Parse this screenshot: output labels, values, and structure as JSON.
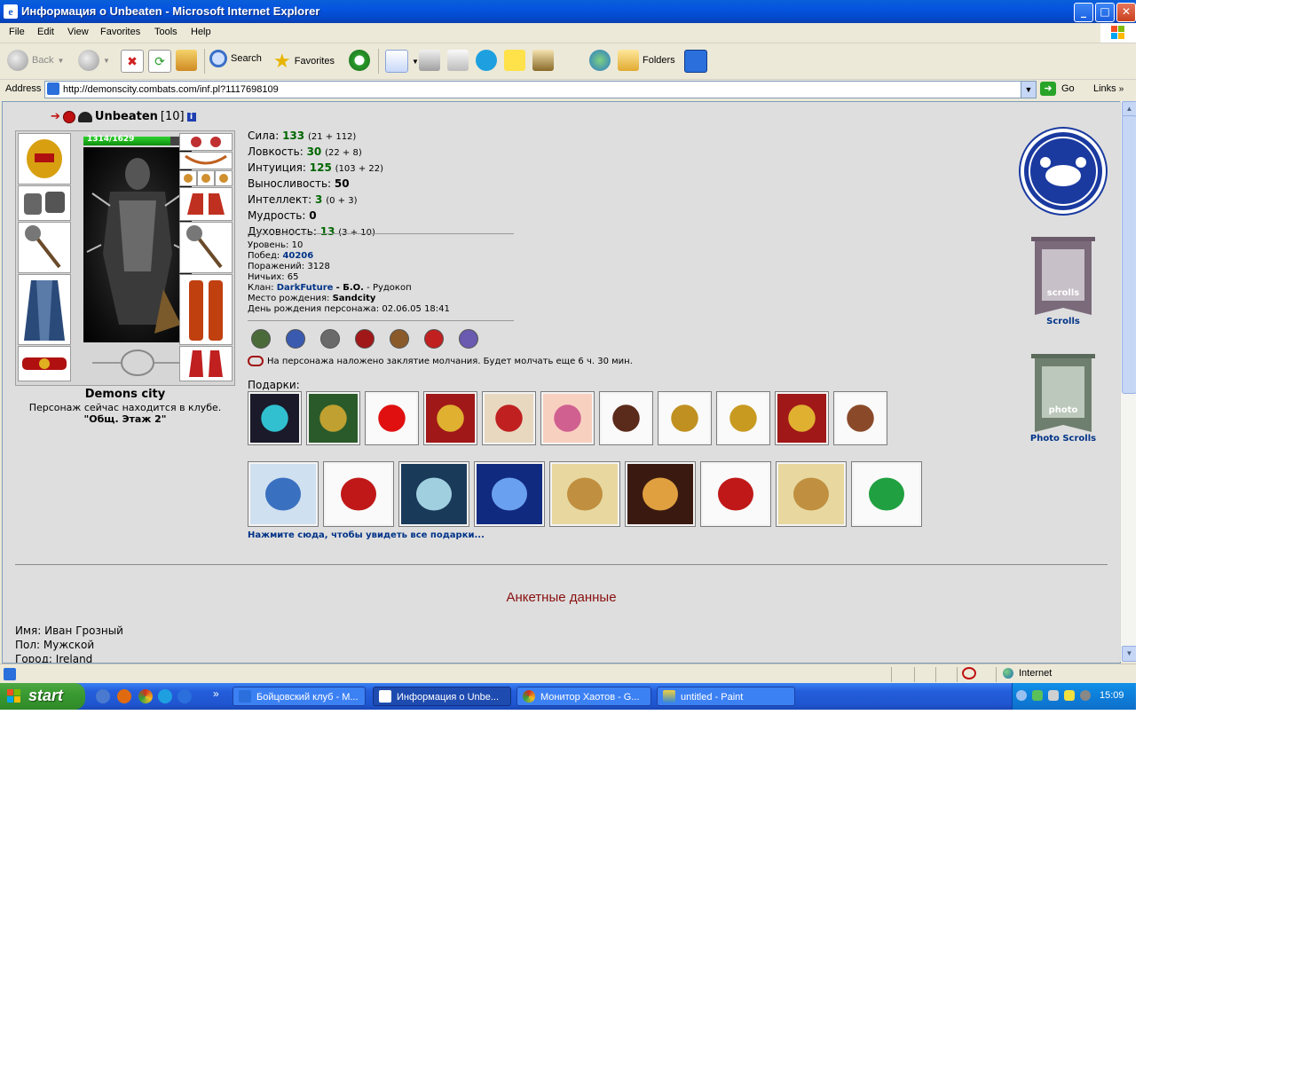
{
  "window": {
    "title": "Информация о Unbeaten - Microsoft Internet Explorer",
    "controls": {
      "minimize": "_",
      "maximize": "□",
      "close": "✕"
    }
  },
  "menu": [
    "File",
    "Edit",
    "View",
    "Favorites",
    "Tools",
    "Help"
  ],
  "toolbar": {
    "back": "Back",
    "search": "Search",
    "favorites": "Favorites",
    "folders": "Folders"
  },
  "address": {
    "label": "Address",
    "url": "http://demonscity.combats.com/inf.pl?1117698109",
    "go": "Go",
    "links": "Links"
  },
  "character": {
    "name": "Unbeaten",
    "level": "[10]",
    "hp": "1314/1629",
    "hp_fraction": 0.807,
    "city": "Demons city",
    "location_line": "Персонаж сейчас находится в клубе.",
    "room": "\"Общ. Этаж 2\""
  },
  "stats": [
    {
      "label": "Сила:",
      "value": "133",
      "base": "(21 + 112)",
      "color": "green"
    },
    {
      "label": "Ловкость:",
      "value": "30",
      "base": "(22 + 8)",
      "color": "green"
    },
    {
      "label": "Интуиция:",
      "value": "125",
      "base": "(103 + 22)",
      "color": "green"
    },
    {
      "label": "Выносливость:",
      "value": "50",
      "base": "",
      "color": "black"
    },
    {
      "label": "Интеллект:",
      "value": "3",
      "base": "(0 + 3)",
      "color": "green"
    },
    {
      "label": "Мудрость:",
      "value": "0",
      "base": "",
      "color": "black"
    },
    {
      "label": "Духовность:",
      "value": "13",
      "base": "(3 + 10)",
      "color": "green"
    }
  ],
  "info": {
    "level": "Уровень: 10",
    "wins_label": "Побед:",
    "wins": "40206",
    "losses": "Поражений: 3128",
    "draws": "Ничьих: 65",
    "clan_label": "Клан:",
    "clan": "DarkFuture",
    "clan_rank": "- Б.О.",
    "clan_role": "- Рудокоп",
    "birthplace_label": "Место рождения:",
    "birthplace": "Sandcity",
    "birthday": "День рождения персонажа: 02.06.05 18:41"
  },
  "silence": "На персонажа наложено заклятие молчания. Будет молчать еще 6 ч. 30 мин.",
  "gifts_label": "Подарки:",
  "gifts_more": "Нажмите сюда, чтобы увидеть все подарки...",
  "gifts_row1": [
    "dark-book-icon",
    "green-book-icon",
    "clown-nose-icon",
    "red-banner-icon",
    "teddy-bear-icon",
    "doll-icon",
    "rocking-horse-icon",
    "medal-icon",
    "golden-dog-icon",
    "red-banner-icon",
    "beer-mug-icon"
  ],
  "gifts_row2": [
    "card-2009-icon",
    "rose-card-icon",
    "card-2007-icon",
    "blue-tree-card-icon",
    "gold-card-icon",
    "card-2008-icon",
    "rose-card-icon",
    "gold-card-icon",
    "presents-icon"
  ],
  "section_title": "Анкетные данные",
  "profile": [
    {
      "label": "Имя:",
      "value": "Иван Грозный"
    },
    {
      "label": "Пол:",
      "value": "Мужской"
    },
    {
      "label": "Город:",
      "value": "Ireland"
    }
  ],
  "sidebar": {
    "scrolls": "Scrolls",
    "photo_scrolls": "Photo Scrolls",
    "scrolls_word": "scrolls",
    "photo_word": "photo"
  },
  "status": {
    "zone": "Internet"
  },
  "taskbar": {
    "start": "start",
    "tasks": [
      "Бойцовский клуб - M...",
      "Информация о Unbe...",
      "Монитор Хаотов - G...",
      "untitled - Paint"
    ],
    "clock": "15:09",
    "more": "»"
  },
  "colors": {
    "accent": "#0554e0",
    "link": "#003388",
    "stat_green": "#006600",
    "heading_red": "#8a1010"
  }
}
